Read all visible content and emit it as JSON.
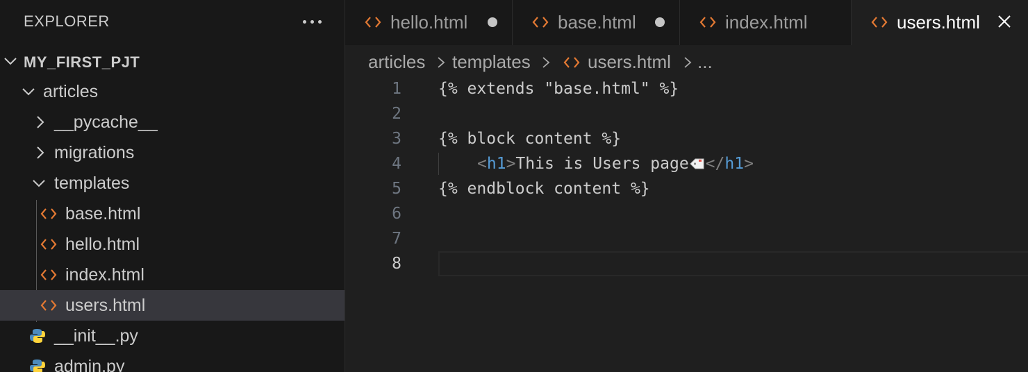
{
  "explorer": {
    "title": "EXPLORER",
    "more_icon": "ellipsis-icon",
    "project": "MY_FIRST_PJT",
    "tree": {
      "articles": "articles",
      "pycache": "__pycache__",
      "migrations": "migrations",
      "templates": "templates",
      "files": [
        "base.html",
        "hello.html",
        "index.html",
        "users.html"
      ],
      "init": "__init__.py",
      "admin": "admin.py"
    },
    "selected": "users.html"
  },
  "tabs": [
    {
      "label": "hello.html",
      "dirty": true,
      "active": false
    },
    {
      "label": "base.html",
      "dirty": true,
      "active": false
    },
    {
      "label": "index.html",
      "dirty": false,
      "active": false
    },
    {
      "label": "users.html",
      "dirty": false,
      "active": true
    }
  ],
  "breadcrumb": [
    "articles",
    "templates",
    "users.html",
    "..."
  ],
  "editor": {
    "line_numbers": [
      "1",
      "2",
      "3",
      "4",
      "5",
      "6",
      "7",
      "8"
    ],
    "current_line": "8",
    "lines": {
      "l1": "{% extends \"base.html\" %}",
      "l3": "{% block content %}",
      "l4_open_lt": "<",
      "l4_open_tag": "h1",
      "l4_open_gt": ">",
      "l4_text": "This is Users page",
      "l4_close_lt": "</",
      "l4_close_tag": "h1",
      "l4_close_gt": ">",
      "l5": "{% endblock content %}"
    }
  },
  "colors": {
    "accent_orange": "#e37933",
    "python_blue": "#4b8bbe",
    "python_yellow": "#ffd43b",
    "tag_blue": "#569cd6"
  }
}
